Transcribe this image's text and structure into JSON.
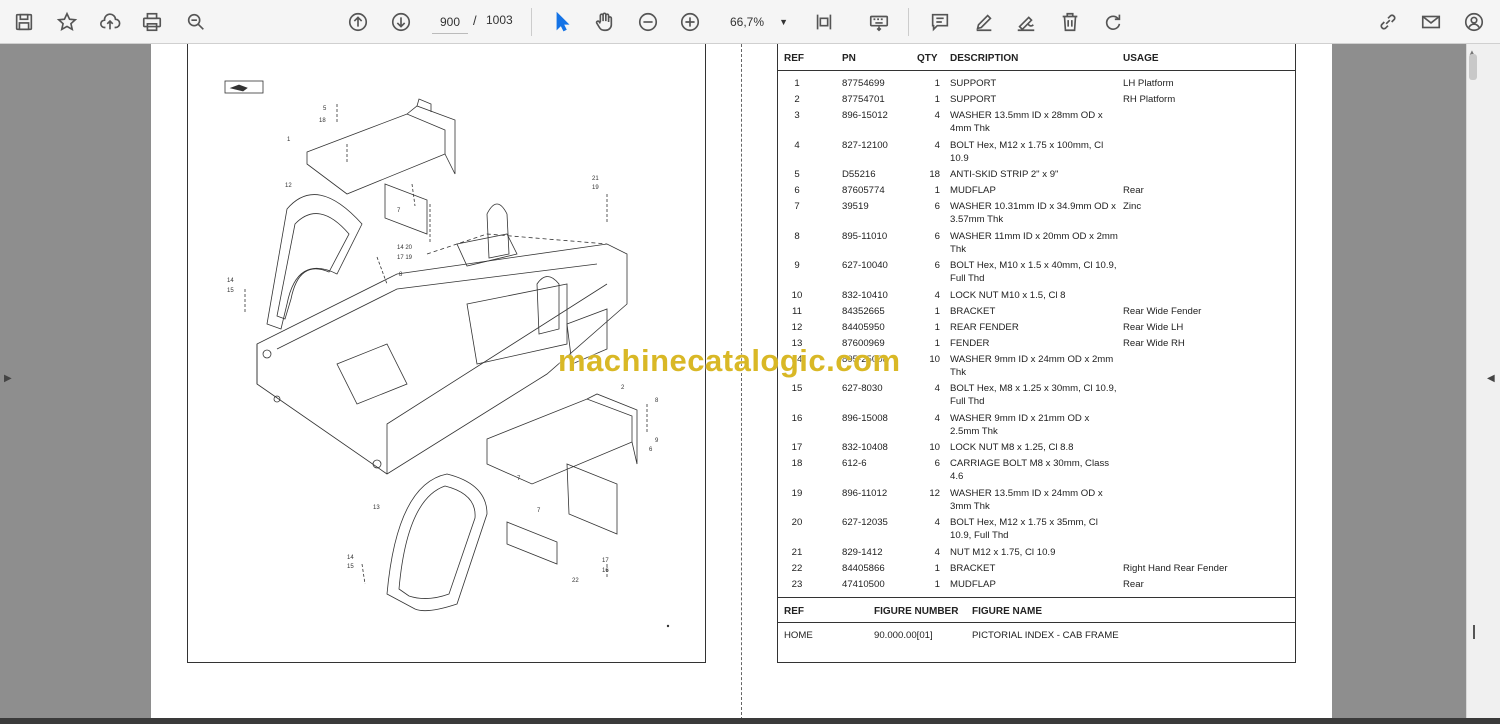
{
  "toolbar": {
    "page_current": "900",
    "page_separator": "/",
    "page_total": "1003",
    "zoom": "66,7%",
    "icons": [
      "save-icon",
      "bookmark-star-icon",
      "upload-icon",
      "print-icon",
      "zoom-search-icon",
      "page-up-icon",
      "page-down-icon",
      "select-pointer-icon",
      "hand-tool-icon",
      "zoom-out-icon",
      "zoom-in-icon",
      "fit-page-icon",
      "keyboard-icon",
      "comment-icon",
      "pen-icon",
      "sign-icon",
      "delete-icon",
      "redo-icon",
      "link-share-icon",
      "mail-icon",
      "account-icon"
    ]
  },
  "table": {
    "headers": {
      "ref": "REF",
      "pn": "PN",
      "qty": "QTY",
      "description": "DESCRIPTION",
      "usage": "USAGE"
    },
    "rows": [
      {
        "ref": "1",
        "pn": "87754699",
        "qty": "1",
        "desc": "SUPPORT",
        "usage": "LH Platform"
      },
      {
        "ref": "2",
        "pn": "87754701",
        "qty": "1",
        "desc": "SUPPORT",
        "usage": "RH Platform"
      },
      {
        "ref": "3",
        "pn": "896-15012",
        "qty": "4",
        "desc": "WASHER 13.5mm ID x 28mm OD x 4mm Thk",
        "usage": ""
      },
      {
        "ref": "4",
        "pn": "827-12100",
        "qty": "4",
        "desc": "BOLT Hex, M12 x 1.75 x 100mm, Cl 10.9",
        "usage": ""
      },
      {
        "ref": "5",
        "pn": "D55216",
        "qty": "18",
        "desc": "ANTI-SKID STRIP 2\" x 9\"",
        "usage": ""
      },
      {
        "ref": "6",
        "pn": "87605774",
        "qty": "1",
        "desc": "MUDFLAP",
        "usage": "Rear"
      },
      {
        "ref": "7",
        "pn": "39519",
        "qty": "6",
        "desc": "WASHER 10.31mm ID x 34.9mm OD x 3.57mm Thk",
        "usage": "Zinc"
      },
      {
        "ref": "8",
        "pn": "895-11010",
        "qty": "6",
        "desc": "WASHER 11mm ID x 20mm OD x 2mm Thk",
        "usage": ""
      },
      {
        "ref": "9",
        "pn": "627-10040",
        "qty": "6",
        "desc": "BOLT Hex, M10 x 1.5 x 40mm, Cl 10.9, Full Thd",
        "usage": ""
      },
      {
        "ref": "10",
        "pn": "832-10410",
        "qty": "4",
        "desc": "LOCK NUT M10 x 1.5, Cl 8",
        "usage": ""
      },
      {
        "ref": "11",
        "pn": "84352665",
        "qty": "1",
        "desc": "BRACKET",
        "usage": "Rear Wide Fender"
      },
      {
        "ref": "12",
        "pn": "84405950",
        "qty": "1",
        "desc": "REAR FENDER",
        "usage": "Rear Wide LH"
      },
      {
        "ref": "13",
        "pn": "87600969",
        "qty": "1",
        "desc": "FENDER",
        "usage": "Rear Wide RH"
      },
      {
        "ref": "14",
        "pn": "895-25008",
        "qty": "10",
        "desc": "WASHER 9mm ID x 24mm OD x 2mm Thk",
        "usage": ""
      },
      {
        "ref": "15",
        "pn": "627-8030",
        "qty": "4",
        "desc": "BOLT Hex, M8 x 1.25 x 30mm, Cl 10.9, Full Thd",
        "usage": ""
      },
      {
        "ref": "16",
        "pn": "896-15008",
        "qty": "4",
        "desc": "WASHER 9mm ID x 21mm OD x 2.5mm Thk",
        "usage": ""
      },
      {
        "ref": "17",
        "pn": "832-10408",
        "qty": "10",
        "desc": "LOCK NUT M8 x 1.25, Cl 8.8",
        "usage": ""
      },
      {
        "ref": "18",
        "pn": "612-6",
        "qty": "6",
        "desc": "CARRIAGE BOLT M8 x 30mm, Class 4.6",
        "usage": ""
      },
      {
        "ref": "19",
        "pn": "896-11012",
        "qty": "12",
        "desc": "WASHER 13.5mm ID x 24mm OD x 3mm Thk",
        "usage": ""
      },
      {
        "ref": "20",
        "pn": "627-12035",
        "qty": "4",
        "desc": "BOLT Hex, M12 x 1.75 x 35mm, Cl 10.9, Full Thd",
        "usage": ""
      },
      {
        "ref": "21",
        "pn": "829-1412",
        "qty": "4",
        "desc": "NUT M12 x 1.75, Cl 10.9",
        "usage": ""
      },
      {
        "ref": "22",
        "pn": "84405866",
        "qty": "1",
        "desc": "BRACKET",
        "usage": "Right Hand Rear Fender"
      },
      {
        "ref": "23",
        "pn": "47410500",
        "qty": "1",
        "desc": "MUDFLAP",
        "usage": "Rear"
      }
    ]
  },
  "figure_table": {
    "headers": {
      "ref": "REF",
      "figure_number": "FIGURE NUMBER",
      "figure_name": "FIGURE NAME"
    },
    "row": {
      "ref": "HOME",
      "figure_number": "90.000.00[01]",
      "figure_name": "PICTORIAL INDEX - CAB FRAME"
    }
  },
  "watermark": "machinecatalogic.com",
  "colors": {
    "toolbar_bg": "#f5f5f5",
    "viewer_bg": "#8e8e8e",
    "watermark": "#d9b826"
  }
}
